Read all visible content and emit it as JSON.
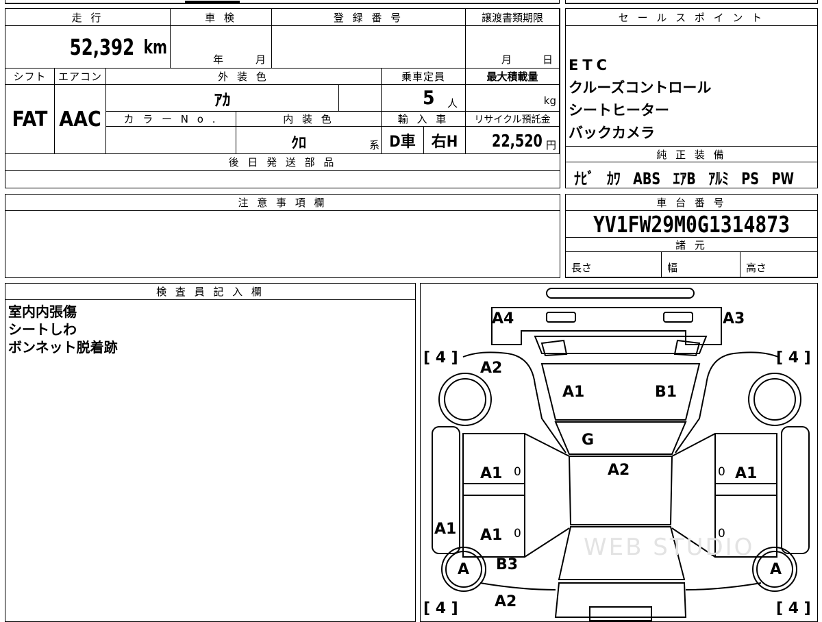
{
  "mileage": {
    "header": "走 行",
    "value": "52,392",
    "unit": "km"
  },
  "shaken": {
    "header": "車 検",
    "year_label": "年",
    "month_label": "月"
  },
  "registration": {
    "header": "登 録 番 号"
  },
  "transfer": {
    "header": "譲渡書類期限",
    "month_label": "月",
    "day_label": "日"
  },
  "shift": {
    "header": "シフト",
    "value": "FAT"
  },
  "aircon": {
    "header": "エアコン",
    "value": "AAC"
  },
  "exterior_color": {
    "header": "外 装 色",
    "value": "ｱｶ"
  },
  "capacity": {
    "header": "乗車定員",
    "value": "5",
    "unit": "人"
  },
  "max_load": {
    "header": "最大積載量",
    "unit": "kg"
  },
  "color_no": {
    "header": "カ ラ ー N o ."
  },
  "interior_color": {
    "header": "内 装 色",
    "value": "ｸﾛ",
    "suffix": "系"
  },
  "import": {
    "header": "輸 入 車",
    "d_car": "D車",
    "right_h": "右H"
  },
  "recycle": {
    "header": "リサイクル預託金",
    "value": "22,520",
    "unit": "円"
  },
  "later_parts": {
    "header": "後 日 発 送 部 品"
  },
  "sales_points": {
    "header": "セ ー ル ス ポ イ ン ト",
    "items": [
      "ETC",
      "クルーズコントロール",
      "シートヒーター",
      "バックカメラ"
    ]
  },
  "genuine_equipment": {
    "header": "純 正 装 備",
    "items": [
      "ﾅﾋﾞ",
      "ｶﾜ",
      "ABS",
      "ｴｱB",
      "ｱﾙﾐ",
      "PS",
      "PW"
    ]
  },
  "notes": {
    "header": "注 意 事 項 欄"
  },
  "chassis": {
    "header": "車 台 番 号",
    "value": "YV1FW29M0G1314873"
  },
  "specs": {
    "header": "諸 元",
    "length_label": "長さ",
    "width_label": "幅",
    "height_label": "高さ"
  },
  "inspector": {
    "header": "検 査 員 記 入 欄",
    "lines": [
      "室内内張傷",
      "シートしわ",
      "ボンネット脱着跡"
    ]
  },
  "diagram": {
    "labels": {
      "a4": "A4",
      "a3": "A3",
      "a2_top": "A2",
      "a1_hood": "A1",
      "b1_hood": "B1",
      "g": "G",
      "a2_roof": "A2",
      "a1_door_fl": "A1",
      "a1_door_fr": "A1",
      "a1_side_l": "A1",
      "a1_door_rl": "A1",
      "b3": "B3",
      "a2_bottom": "A2",
      "a_wheel_l": "A",
      "a_wheel_r": "A"
    },
    "brackets": {
      "tl": "[ 4 ]",
      "tr": "[ 4 ]",
      "bl": "[ 4 ]",
      "br": "[ 4 ]"
    },
    "zeros": [
      "0",
      "0",
      "0",
      "0"
    ],
    "watermark": "WEB STUDIO"
  }
}
